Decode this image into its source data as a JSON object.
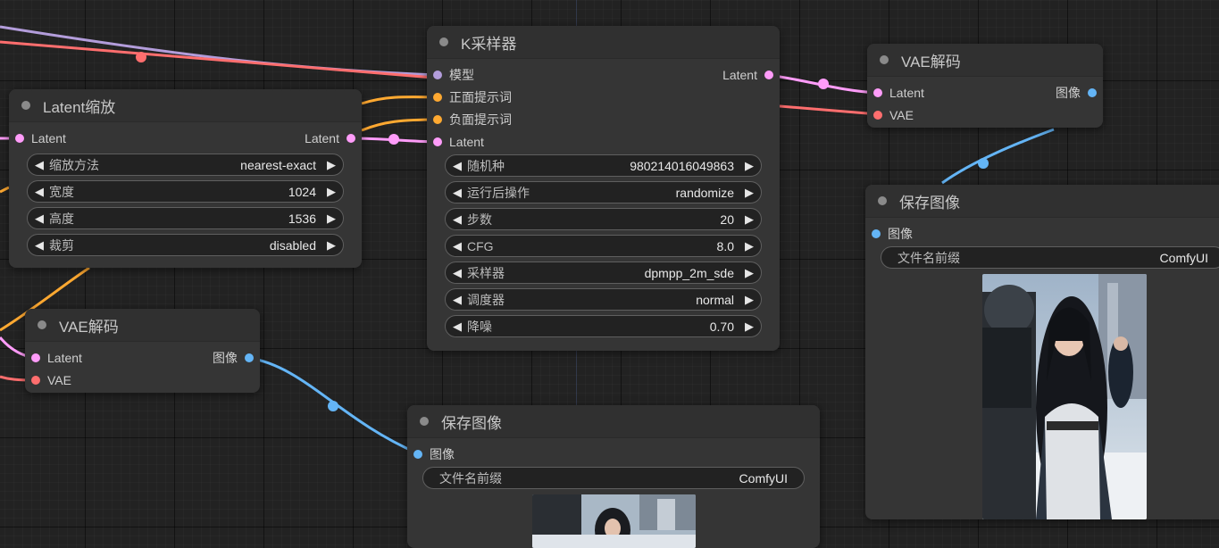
{
  "colors": {
    "model": "#b39ddb",
    "conditioning": "#ffa931",
    "latent": "#ff9cf9",
    "vae": "#ff6e6e",
    "image": "#64b5f6"
  },
  "k_sampler": {
    "title": "K采样器",
    "inputs": [
      "模型",
      "正面提示词",
      "负面提示词",
      "Latent"
    ],
    "output": "Latent",
    "widgets": [
      {
        "label": "随机种",
        "value": "980214016049863"
      },
      {
        "label": "运行后操作",
        "value": "randomize"
      },
      {
        "label": "步数",
        "value": "20"
      },
      {
        "label": "CFG",
        "value": "8.0"
      },
      {
        "label": "采样器",
        "value": "dpmpp_2m_sde"
      },
      {
        "label": "调度器",
        "value": "normal"
      },
      {
        "label": "降噪",
        "value": "0.70"
      }
    ]
  },
  "latent_upscale": {
    "title": "Latent缩放",
    "input": "Latent",
    "output": "Latent",
    "widgets": [
      {
        "label": "缩放方法",
        "value": "nearest-exact"
      },
      {
        "label": "宽度",
        "value": "1024"
      },
      {
        "label": "高度",
        "value": "1536"
      },
      {
        "label": "裁剪",
        "value": "disabled"
      }
    ]
  },
  "vae_decode_top": {
    "title": "VAE解码",
    "inputs": [
      "Latent",
      "VAE"
    ],
    "output": "图像"
  },
  "vae_decode_left": {
    "title": "VAE解码",
    "inputs": [
      "Latent",
      "VAE"
    ],
    "output": "图像"
  },
  "save_image_right": {
    "title": "保存图像",
    "input": "图像",
    "prefix_label": "文件名前缀",
    "prefix_value": "ComfyUI"
  },
  "save_image_bottom": {
    "title": "保存图像",
    "input": "图像",
    "prefix_label": "文件名前缀",
    "prefix_value": "ComfyUI"
  },
  "arrows": {
    "left": "◀",
    "right": "▶"
  }
}
